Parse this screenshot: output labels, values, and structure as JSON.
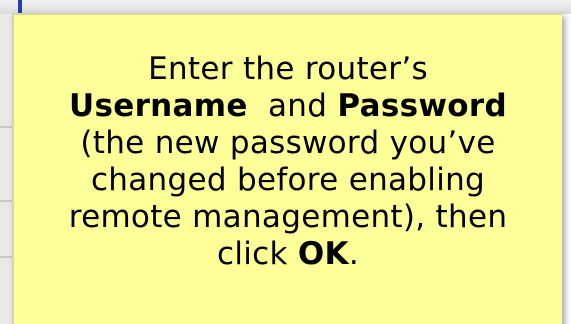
{
  "callout": {
    "line1": "Enter the router’s",
    "username_label": "Username",
    "and_text": "and",
    "password_label": "Password",
    "line3": "(the new password you’ve",
    "line4": "changed before enabling",
    "line5": "remote management), then",
    "click_text": "click",
    "ok_label": "OK",
    "period": "."
  },
  "colors": {
    "callout_background": "#ffff99",
    "accent_blue": "#1f3fb3"
  }
}
